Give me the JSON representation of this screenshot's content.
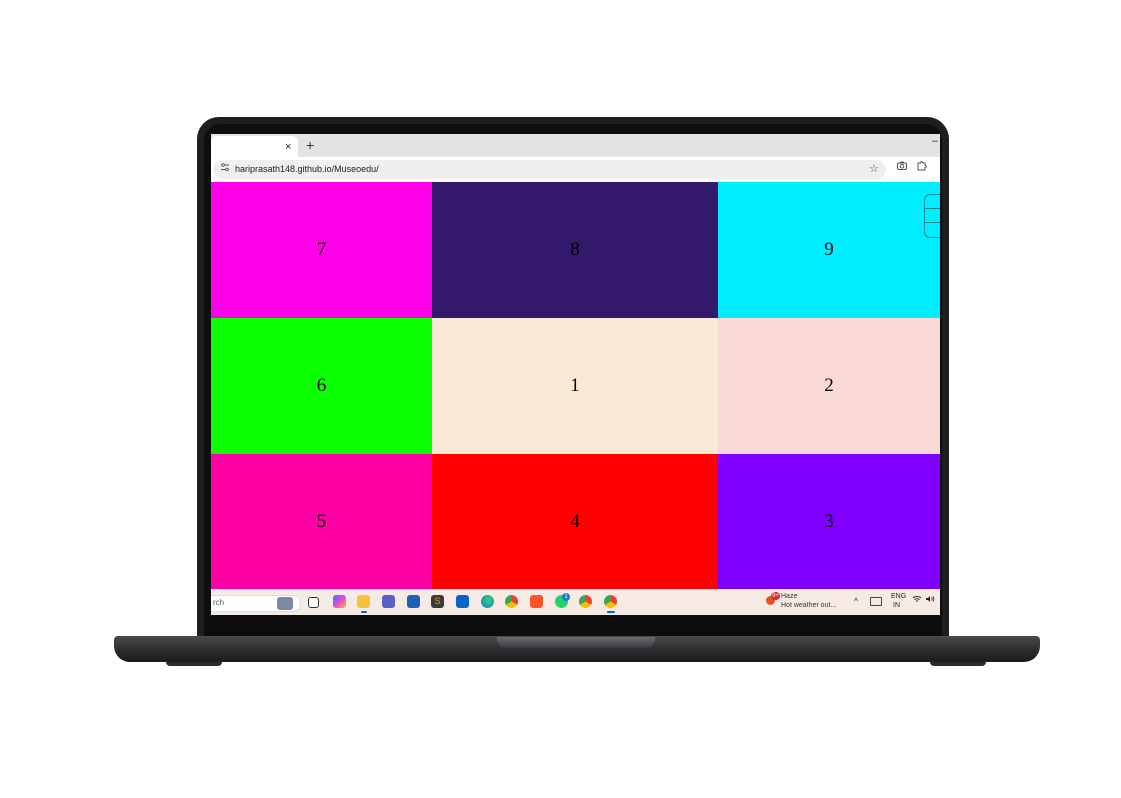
{
  "browser": {
    "tab_close": "×",
    "new_tab": "+",
    "window_control": "–",
    "url": "hariprasath148.github.io/Museoedu/",
    "icons": [
      "site-info-icon",
      "bookmark-star-icon",
      "screenshot-icon",
      "extensions-icon"
    ]
  },
  "grid": {
    "cells": [
      {
        "label": "7",
        "color": "#ff00e8"
      },
      {
        "label": "8",
        "color": "#33196b"
      },
      {
        "label": "9",
        "color": "#00ecff"
      },
      {
        "label": "6",
        "color": "#0cff00"
      },
      {
        "label": "1",
        "color": "#f9ead8"
      },
      {
        "label": "2",
        "color": "#f9dad6"
      },
      {
        "label": "5",
        "color": "#ff00a4"
      },
      {
        "label": "4",
        "color": "#ff0000"
      },
      {
        "label": "3",
        "color": "#8000ff"
      }
    ]
  },
  "taskbar": {
    "search_text": "rch",
    "weather_badge": "9+",
    "weather_title": "Haze",
    "weather_sub": "Hot weather out...",
    "language_line1": "ENG",
    "language_line2": "IN",
    "whatsapp_badge": "1",
    "icons": [
      "task-view-icon",
      "copilot-icon",
      "file-explorer-icon",
      "teams-icon",
      "store-icon",
      "sublime-icon",
      "outlook-icon",
      "edge-icon",
      "chrome-icon",
      "brave-icon",
      "whatsapp-icon",
      "chrome-profile-icon",
      "chrome-active-icon"
    ]
  }
}
